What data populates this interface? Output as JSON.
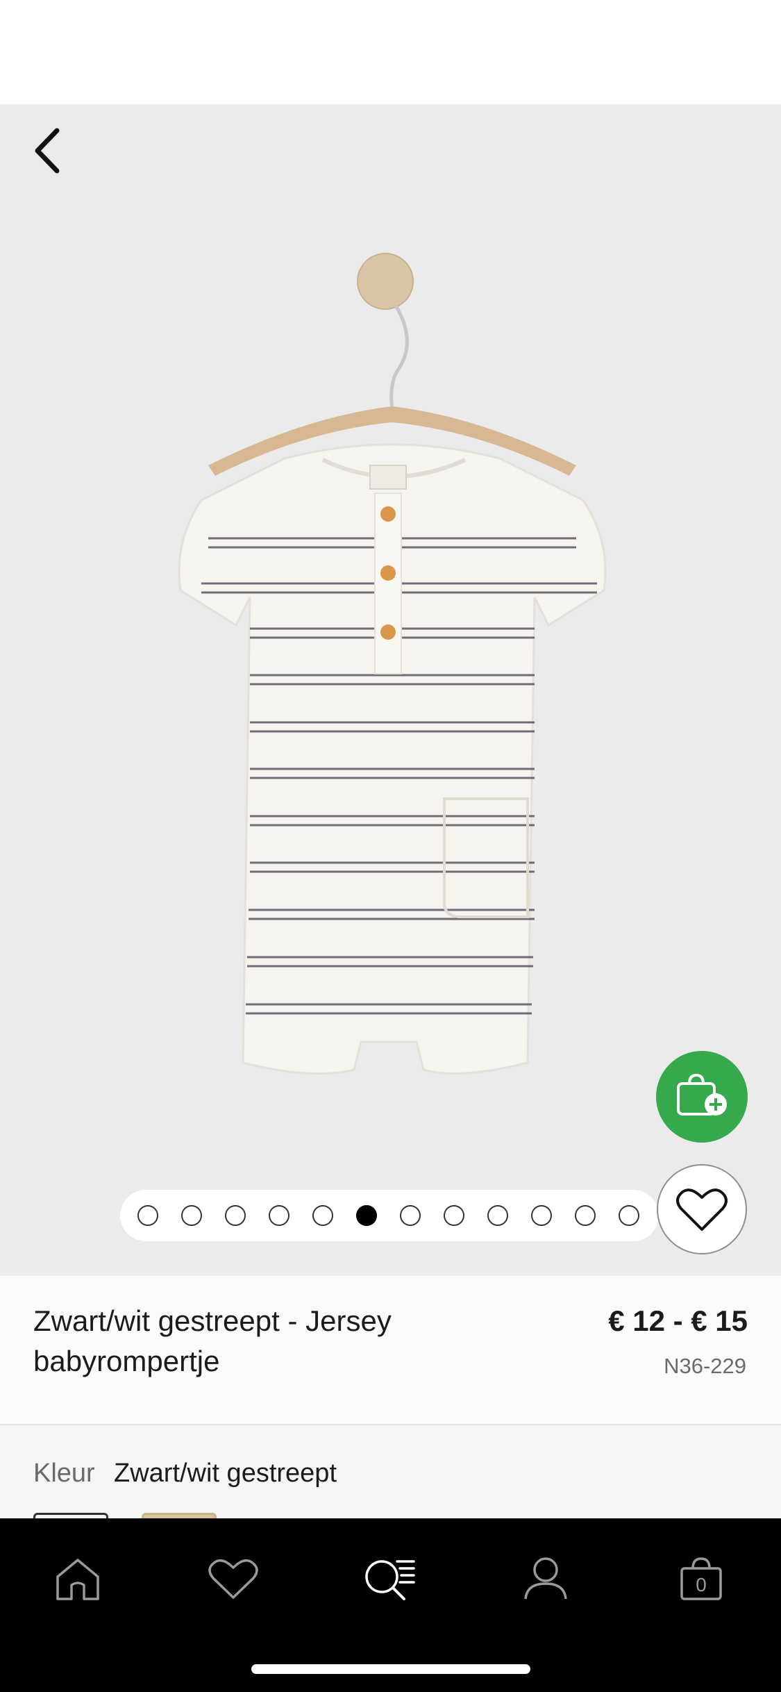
{
  "product": {
    "title": "Zwart/wit gestreept - Jersey babyrompertje",
    "price": "€ 12 - € 15",
    "code": "N36-229"
  },
  "colour": {
    "label": "Kleur",
    "value": "Zwart/wit gestreept"
  },
  "gallery": {
    "image_count": 12,
    "active_index": 5
  },
  "cart": {
    "count": "0"
  },
  "icons": {
    "back": "chevron-left-icon",
    "add_to_bag": "shopping-bag-plus-icon",
    "wishlist": "heart-icon",
    "tabs": [
      "home-icon",
      "heart-icon",
      "search-menu-icon",
      "account-icon",
      "bag-icon"
    ]
  },
  "colors": {
    "accent_green": "#35a94b",
    "tabbar_bg": "#000000",
    "hero_bg": "#ebebeb"
  }
}
